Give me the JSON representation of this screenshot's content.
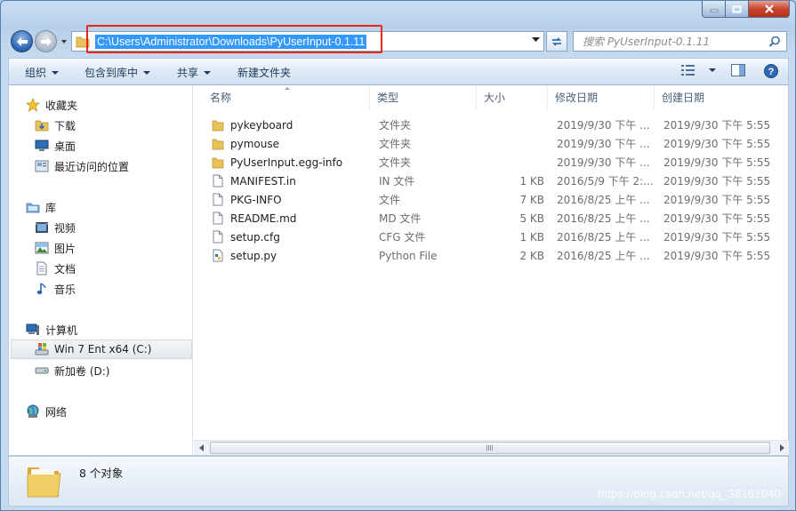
{
  "window": {
    "caption": {
      "min": "minimize",
      "max": "maximize",
      "close": "close"
    }
  },
  "address_bar": {
    "path": "C:\\Users\\Administrator\\Downloads\\PyUserInput-0.1.11",
    "search_placeholder": "搜索 PyUserInput-0.1.11"
  },
  "toolbar": {
    "organize": "组织",
    "include_in_library": "包含到库中",
    "share": "共享",
    "new_folder": "新建文件夹"
  },
  "nav_pane": {
    "favorites": {
      "label": "收藏夹",
      "items": [
        "下载",
        "桌面",
        "最近访问的位置"
      ]
    },
    "libraries": {
      "label": "库",
      "items": [
        "视频",
        "图片",
        "文档",
        "音乐"
      ]
    },
    "computer": {
      "label": "计算机",
      "items": [
        "Win 7 Ent x64 (C:)",
        "新加卷 (D:)"
      ]
    },
    "network": {
      "label": "网络"
    }
  },
  "columns": {
    "name": "名称",
    "type": "类型",
    "size": "大小",
    "modified": "修改日期",
    "created": "创建日期"
  },
  "files": [
    {
      "name": "pykeyboard",
      "type": "文件夹",
      "size": "",
      "modified": "2019/9/30 下午 ...",
      "created": "2019/9/30 下午 5:55",
      "icon": "folder"
    },
    {
      "name": "pymouse",
      "type": "文件夹",
      "size": "",
      "modified": "2019/9/30 下午 ...",
      "created": "2019/9/30 下午 5:55",
      "icon": "folder"
    },
    {
      "name": "PyUserInput.egg-info",
      "type": "文件夹",
      "size": "",
      "modified": "2019/9/30 下午 ...",
      "created": "2019/9/30 下午 5:55",
      "icon": "folder"
    },
    {
      "name": "MANIFEST.in",
      "type": "IN 文件",
      "size": "1 KB",
      "modified": "2016/5/9 下午 2:...",
      "created": "2019/9/30 下午 5:55",
      "icon": "file"
    },
    {
      "name": "PKG-INFO",
      "type": "文件",
      "size": "7 KB",
      "modified": "2016/8/25 上午 ...",
      "created": "2019/9/30 下午 5:55",
      "icon": "file"
    },
    {
      "name": "README.md",
      "type": "MD 文件",
      "size": "5 KB",
      "modified": "2016/8/25 上午 ...",
      "created": "2019/9/30 下午 5:55",
      "icon": "file"
    },
    {
      "name": "setup.cfg",
      "type": "CFG 文件",
      "size": "1 KB",
      "modified": "2016/8/25 上午 ...",
      "created": "2019/9/30 下午 5:55",
      "icon": "file"
    },
    {
      "name": "setup.py",
      "type": "Python File",
      "size": "2 KB",
      "modified": "2016/8/25 上午 ...",
      "created": "2019/9/30 下午 5:55",
      "icon": "python-file"
    }
  ],
  "details": {
    "count": "8 个对象"
  },
  "watermark": "https://blog.csdn.net/qq_38161040"
}
